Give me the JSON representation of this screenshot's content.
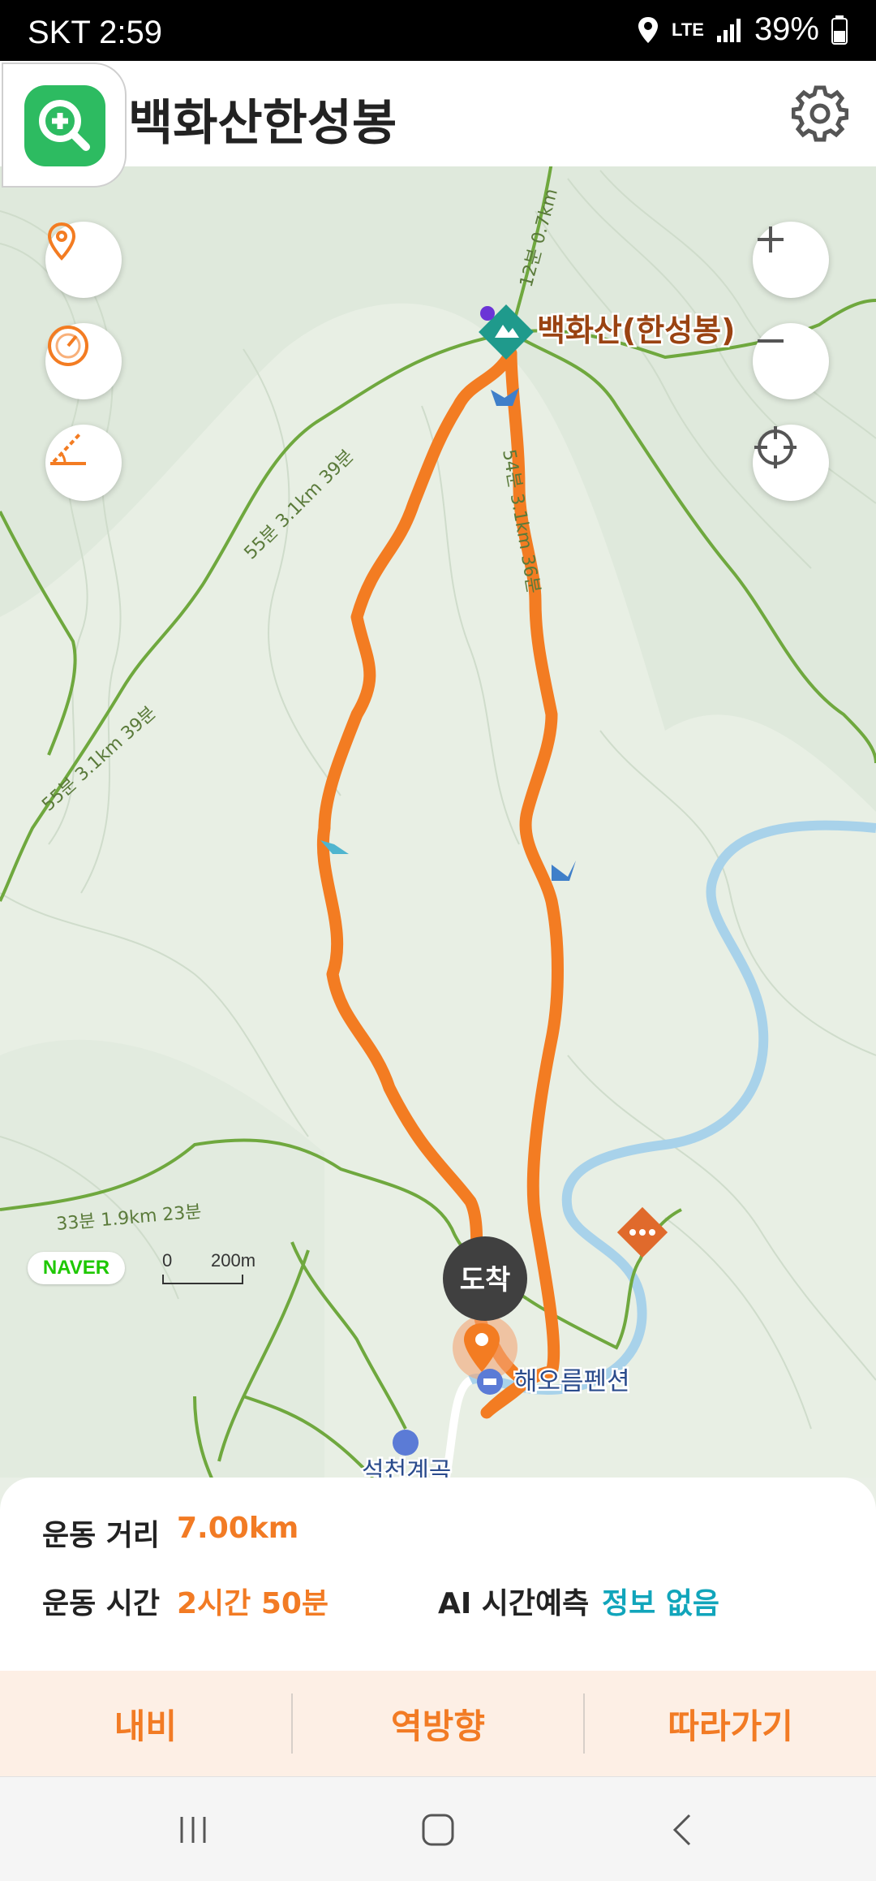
{
  "status_bar": {
    "carrier_time": "SKT 2:59",
    "network": "LTE",
    "battery": "39%"
  },
  "header": {
    "title": "백화산한성봉",
    "zoom_icon": "search-plus-icon",
    "settings_icon": "gear-icon"
  },
  "map": {
    "summit_label": "백화산(한성봉)",
    "arrival_label": "도착",
    "pension_label": "해오름펜션",
    "partial_label": "석천계곡",
    "trail_labels": [
      "12분 0.7km",
      "55분 3.1km 39분",
      "55분 3.1km 39분",
      "33분 1.9km 23분",
      "54분 3.1km 36분"
    ],
    "brand": "NAVER",
    "scale_zero": "0",
    "scale_length": "200m",
    "route_color": "#f37c22",
    "trail_color": "#6fa83e",
    "river_color": "#a8d2ea"
  },
  "stats": {
    "distance_label": "운동 거리",
    "distance_value": "7.00km",
    "time_label": "운동 시간",
    "time_value": "2시간 50분",
    "ai_label": "AI 시간예측",
    "ai_value": "정보 없음"
  },
  "actions": {
    "navi": "내비",
    "reverse": "역방향",
    "follow": "따라가기"
  },
  "nav_bar": {
    "recent_icon": "recent-apps-icon",
    "home_icon": "home-icon",
    "back_icon": "back-icon"
  }
}
